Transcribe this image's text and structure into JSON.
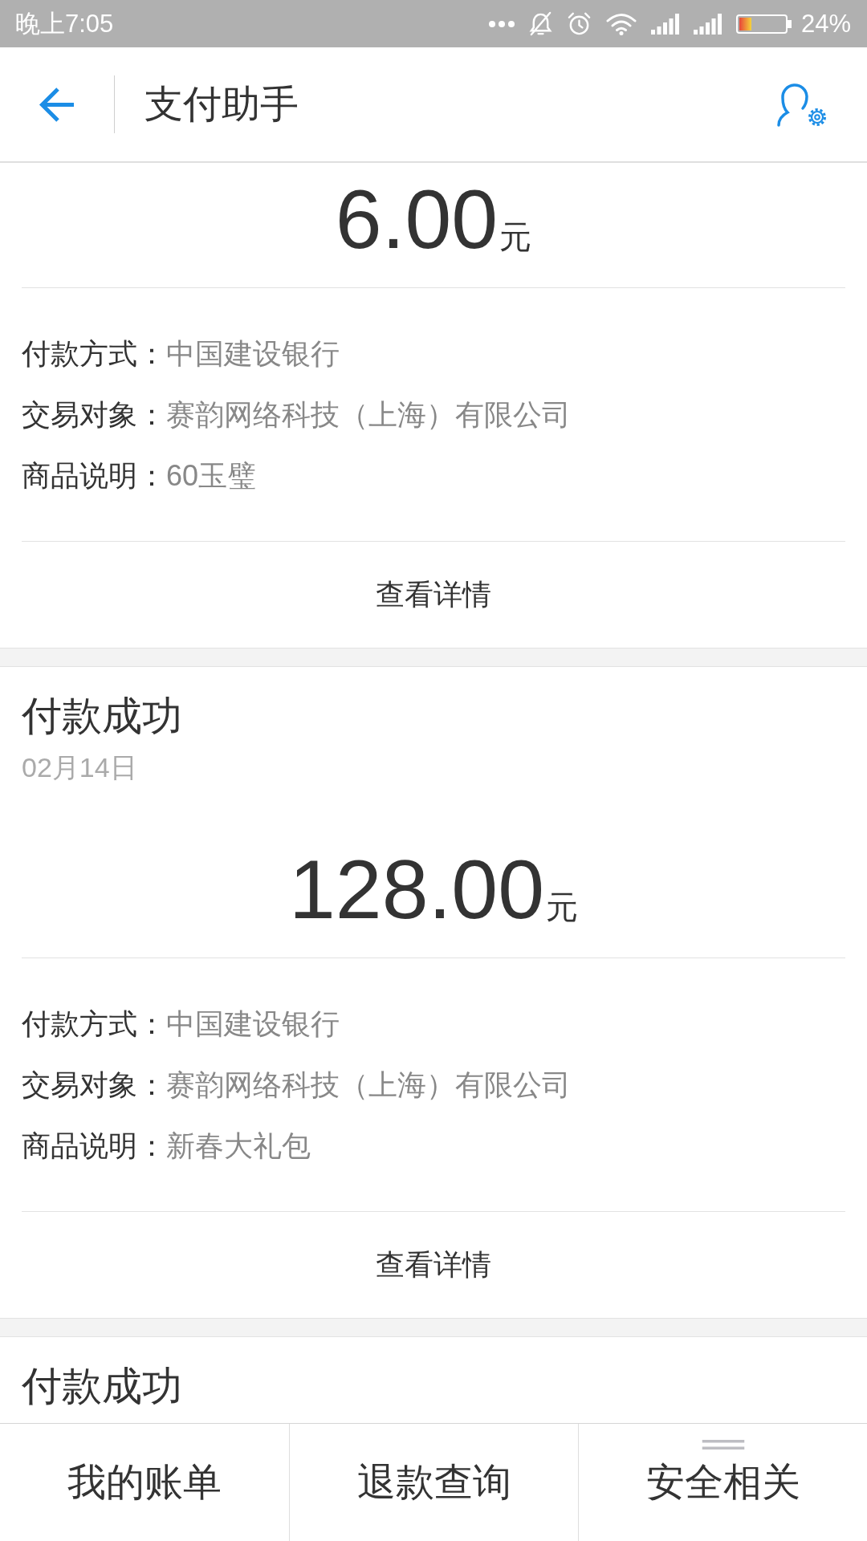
{
  "status_bar": {
    "time": "晚上7:05",
    "battery_text": "24%"
  },
  "header": {
    "title": "支付助手"
  },
  "cards": [
    {
      "amount": "6.00",
      "unit": "元",
      "details": [
        {
          "label": "付款方式：",
          "value": "中国建设银行"
        },
        {
          "label": "交易对象：",
          "value": "赛韵网络科技（上海）有限公司"
        },
        {
          "label": "商品说明：",
          "value": "60玉璧"
        }
      ],
      "link": "查看详情"
    },
    {
      "title": "付款成功",
      "date": "02月14日",
      "amount": "128.00",
      "unit": "元",
      "details": [
        {
          "label": "付款方式：",
          "value": "中国建设银行"
        },
        {
          "label": "交易对象：",
          "value": "赛韵网络科技（上海）有限公司"
        },
        {
          "label": "商品说明：",
          "value": "新春大礼包"
        }
      ],
      "link": "查看详情"
    },
    {
      "title": "付款成功"
    }
  ],
  "bottom_nav": [
    {
      "label": "我的账单",
      "kind": "plain"
    },
    {
      "label": "退款查询",
      "kind": "plain"
    },
    {
      "label": "安全相关",
      "kind": "menu"
    }
  ]
}
